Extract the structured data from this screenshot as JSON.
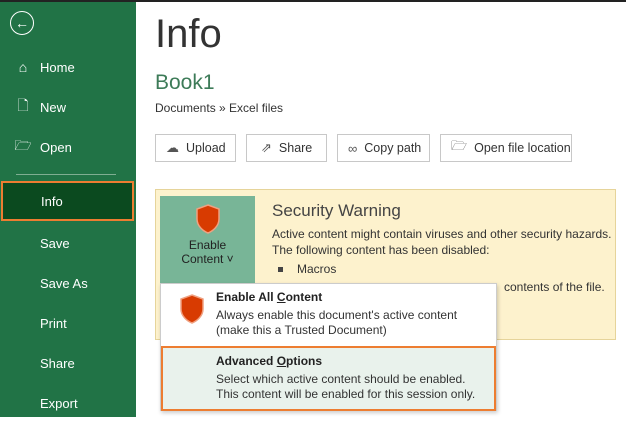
{
  "sidebar": {
    "back_label": "Back",
    "items": [
      {
        "label": "Home",
        "icon": "home-icon"
      },
      {
        "label": "New",
        "icon": "new-file-icon"
      },
      {
        "label": "Open",
        "icon": "folder-open-icon"
      },
      {
        "label": "Info",
        "active": true
      },
      {
        "label": "Save"
      },
      {
        "label": "Save As"
      },
      {
        "label": "Print"
      },
      {
        "label": "Share"
      },
      {
        "label": "Export"
      }
    ]
  },
  "header": {
    "title": "Info",
    "file_name": "Book1",
    "breadcrumb": "Documents » Excel files"
  },
  "actions": [
    {
      "label": "Upload",
      "icon": "upload-cloud-icon"
    },
    {
      "label": "Share",
      "icon": "share-icon"
    },
    {
      "label": "Copy path",
      "icon": "link-icon"
    },
    {
      "label": "Open file location",
      "icon": "folder-open-icon"
    }
  ],
  "security": {
    "title": "Security Warning",
    "line1": "Active content might contain viruses and other security hazards.",
    "line2": "The following content has been disabled:",
    "bullet": "Macros",
    "trailing": "contents of the file.",
    "button_line1": "Enable",
    "button_line2": "Content ˅",
    "accent": "#ed7d31"
  },
  "dropdown": [
    {
      "title_pre": "Enable All ",
      "title_u": "C",
      "title_post": "ontent",
      "line1": "Always enable this document's active content",
      "line2": "(make this a Trusted Document)"
    },
    {
      "title_pre": "Advanced ",
      "title_u": "O",
      "title_post": "ptions",
      "line1": "Select which active content should be enabled.",
      "line2": "This content will be enabled for this session only."
    }
  ]
}
